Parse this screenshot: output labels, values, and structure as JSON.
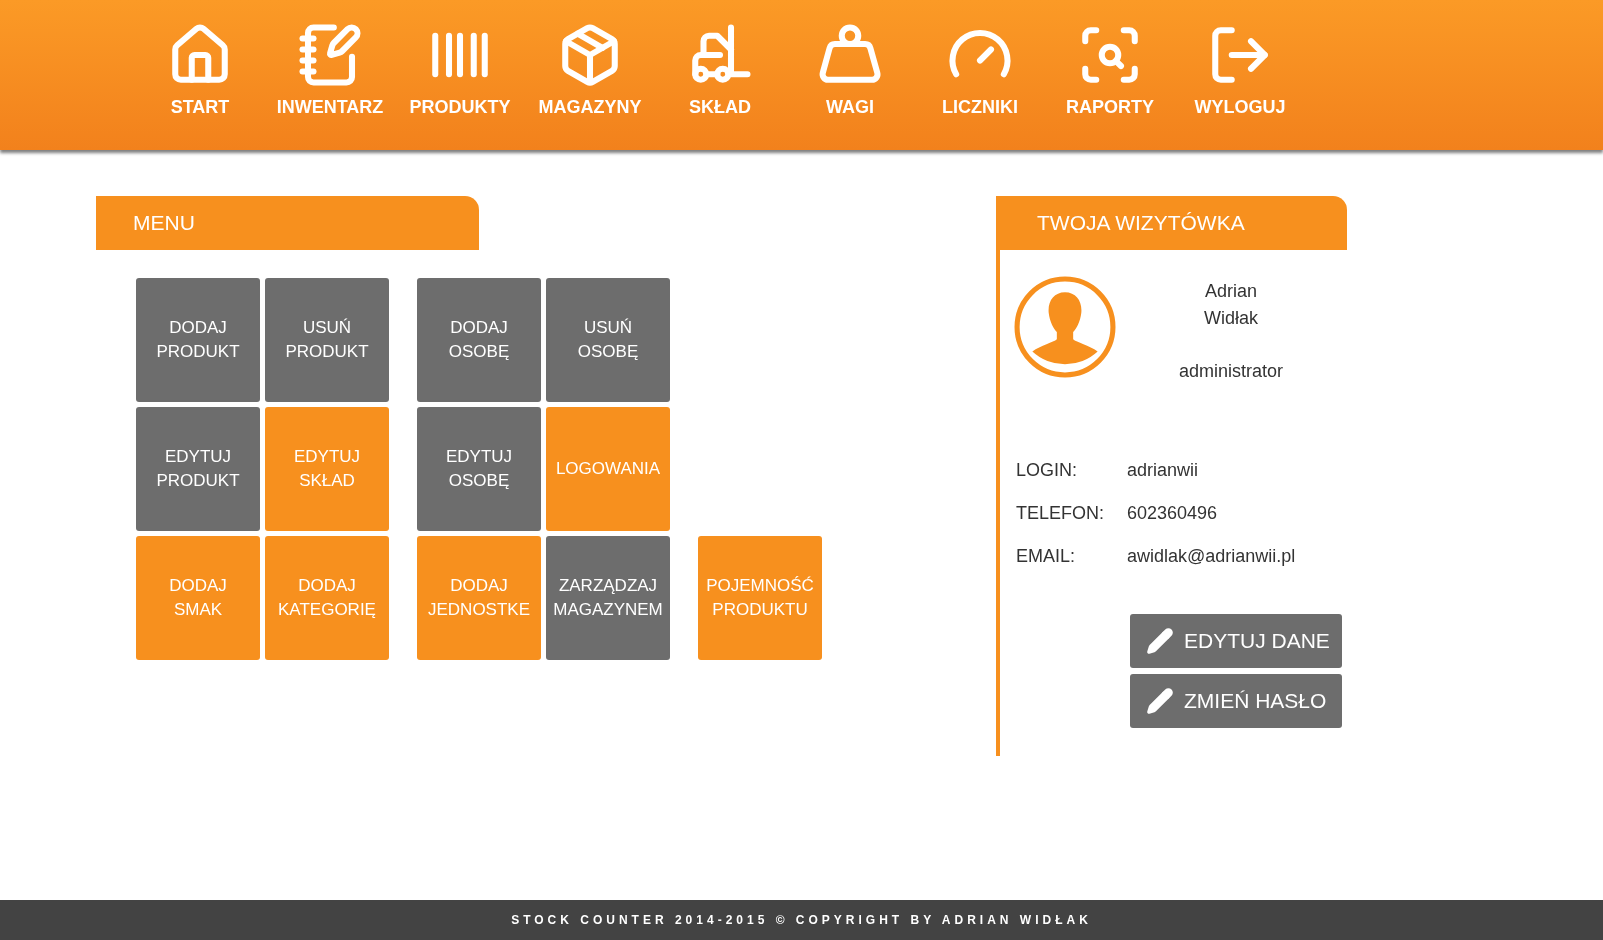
{
  "nav": [
    {
      "label": "START"
    },
    {
      "label": "INWENTARZ"
    },
    {
      "label": "PRODUKTY"
    },
    {
      "label": "MAGAZYNY"
    },
    {
      "label": "SKŁAD"
    },
    {
      "label": "WAGI"
    },
    {
      "label": "LICZNIKI"
    },
    {
      "label": "RAPORTY"
    },
    {
      "label": "WYLOGUJ"
    }
  ],
  "menu": {
    "title": "MENU",
    "groups": [
      [
        {
          "label": "DODAJ PRODUKT",
          "color": "#6d6d6d"
        },
        {
          "label": "USUŃ PRODUKT",
          "color": "#6d6d6d"
        },
        {
          "label": "EDYTUJ PRODUKT",
          "color": "#6d6d6d"
        },
        {
          "label": "EDYTUJ SKŁAD",
          "color": "#f7901e"
        },
        {
          "label": "DODAJ SMAK",
          "color": "#f7901e"
        },
        {
          "label": "DODAJ KATEGORIĘ",
          "color": "#f7901e"
        }
      ],
      [
        {
          "label": "DODAJ OSOBĘ",
          "color": "#6d6d6d"
        },
        {
          "label": "USUŃ OSOBĘ",
          "color": "#6d6d6d"
        },
        {
          "label": "EDYTUJ OSOBĘ",
          "color": "#6d6d6d"
        },
        {
          "label": "LOGOWANIA",
          "color": "#f7901e"
        },
        {
          "label": "DODAJ JEDNOSTKE",
          "color": "#f7901e"
        },
        {
          "label": "ZARZĄDZAJ MAGAZYNEM",
          "color": "#6d6d6d"
        }
      ],
      [
        {
          "label": "POJEMNOŚĆ PRODUKTU",
          "color": "#f7901e"
        }
      ]
    ]
  },
  "card": {
    "title": "TWOJA WIZYTÓWKA",
    "first_name": "Adrian",
    "last_name": "Widłak",
    "role": "administrator",
    "fields": [
      {
        "label": "LOGIN:",
        "value": "adrianwii"
      },
      {
        "label": "TELEFON:",
        "value": "602360496"
      },
      {
        "label": "EMAIL:",
        "value": "awidlak@adrianwii.pl"
      }
    ],
    "buttons": [
      "EDYTUJ DANE",
      "ZMIEŃ HASŁO"
    ]
  },
  "footer": "STOCK COUNTER 2014-2015 © COPYRIGHT BY ADRIAN WIDŁAK"
}
